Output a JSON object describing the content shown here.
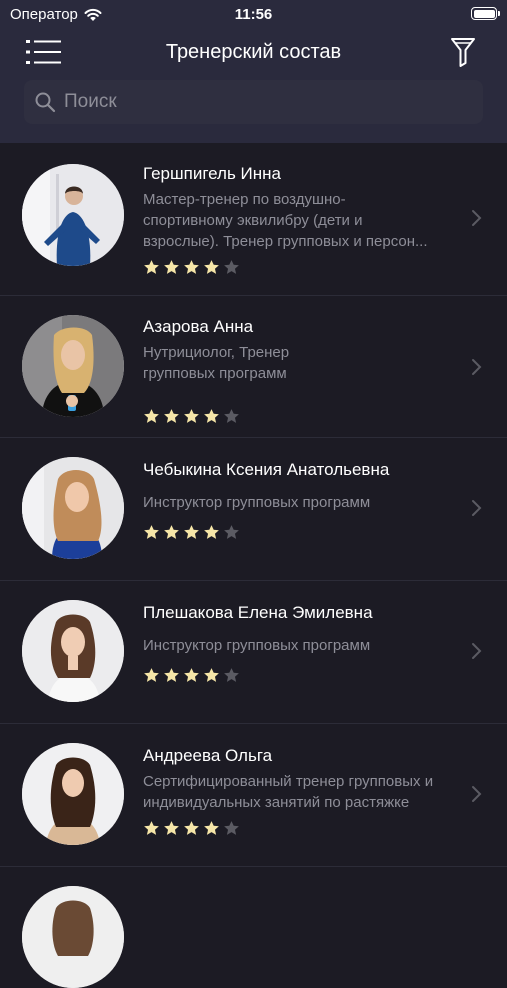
{
  "status": {
    "carrier": "Оператор",
    "time": "11:56"
  },
  "nav": {
    "title": "Тренерский состав"
  },
  "search": {
    "placeholder": "Поиск"
  },
  "trainers": [
    {
      "name": "Гершпигель Инна",
      "desc": [
        "Мастер-тренер по воздушно-",
        "спортивному эквилибру (дети и",
        "взрослые). Тренер групповых и персон..."
      ],
      "rating": 4,
      "max": 5
    },
    {
      "name": "Азарова Анна",
      "desc": [
        "Нутрициолог, Тренер",
        "групповых программ"
      ],
      "rating": 4,
      "max": 5
    },
    {
      "name": "Чебыкина Ксения Анатольевна",
      "desc": [
        "Инструктор групповых программ"
      ],
      "rating": 4,
      "max": 5
    },
    {
      "name": "Плешакова Елена Эмилевна",
      "desc": [
        "Инструктор групповых программ"
      ],
      "rating": 4,
      "max": 5
    },
    {
      "name": "Андреева Ольга",
      "desc": [
        "Сертифицированный тренер групповых и",
        "индивидуальных занятий по растяжке"
      ],
      "rating": 4,
      "max": 5
    }
  ],
  "colors": {
    "star_on": "#f6e6a8",
    "star_off": "#5b5b63",
    "accent_bg": "#2a2a3d"
  }
}
